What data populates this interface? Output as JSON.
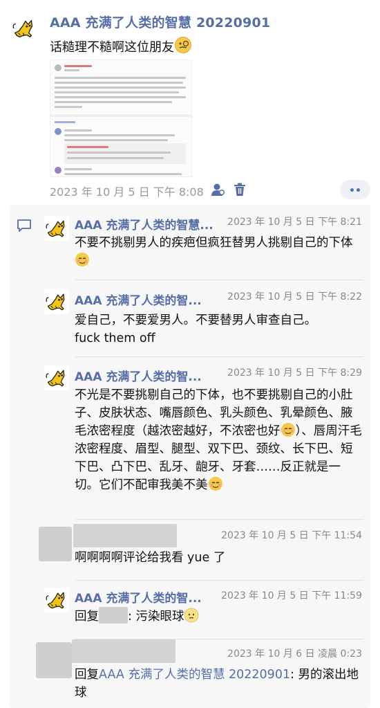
{
  "post": {
    "title": "AAA 充满了人类的智慧 20220901",
    "text": "话糙理不糙啊这位朋友",
    "emoji": "monocle-face-emoji",
    "timestamp": "2023 年 10 月 5 日 下午 8:08",
    "icons": {
      "person": "person-icon",
      "delete": "trash-icon",
      "more": "more-dots-icon"
    }
  },
  "comments": [
    {
      "name": "AAA 充满了人类的智慧...",
      "time": "2023 年 10 月 5 日 下午 8:21",
      "text": "不要不挑剔男人的疾疤但疯狂替男人挑剔自己的下体"
    },
    {
      "name": "AAA 充满了人类的智...",
      "time": "2023 年 10 月 5 日 下午 8:22",
      "text_line1": "爱自己，不要爱男人。不要替男人审查自己。",
      "text_line2": "fuck them off"
    },
    {
      "name": "AAA 充满了人类的智...",
      "time": "2023 年 10 月 5 日 下午 8:29",
      "text_part1": "不光是不要挑剔自己的下体，也不要挑剔自己的小肚子、皮肤状态、嘴唇颜色、乳头颜色、乳晕颜色、腋毛浓密程度（越浓密越好，不浓密也好",
      "text_part2": "）、唇周汗毛浓密程度、眉型、腿型、双下巴、颈纹、长下巴、短下巴、凸下巴、乱牙、龅牙、牙套……反正就是一切。它们不配审我美不美"
    },
    {
      "time": "2023 年 10 月 5 日 下午 11:54",
      "text": "啊啊啊啊评论给我看 yue 了"
    },
    {
      "name": "AAA 充满了人类的智...",
      "time": "2023 年 10 月 5 日 下午 11:59",
      "reply_prefix": "回复",
      "text": ": 污染眼球"
    },
    {
      "time": "2023 年 10 月 6 日 凌晨 0:23",
      "reply_prefix": "回复",
      "reply_to": "AAA 充满了人类的智慧 20220901",
      "text": ": 男的滚出地球"
    }
  ],
  "colors": {
    "name_blue": "#566ea8",
    "timestamp_gray": "#999999",
    "comment_bg": "#f7f7f7"
  }
}
